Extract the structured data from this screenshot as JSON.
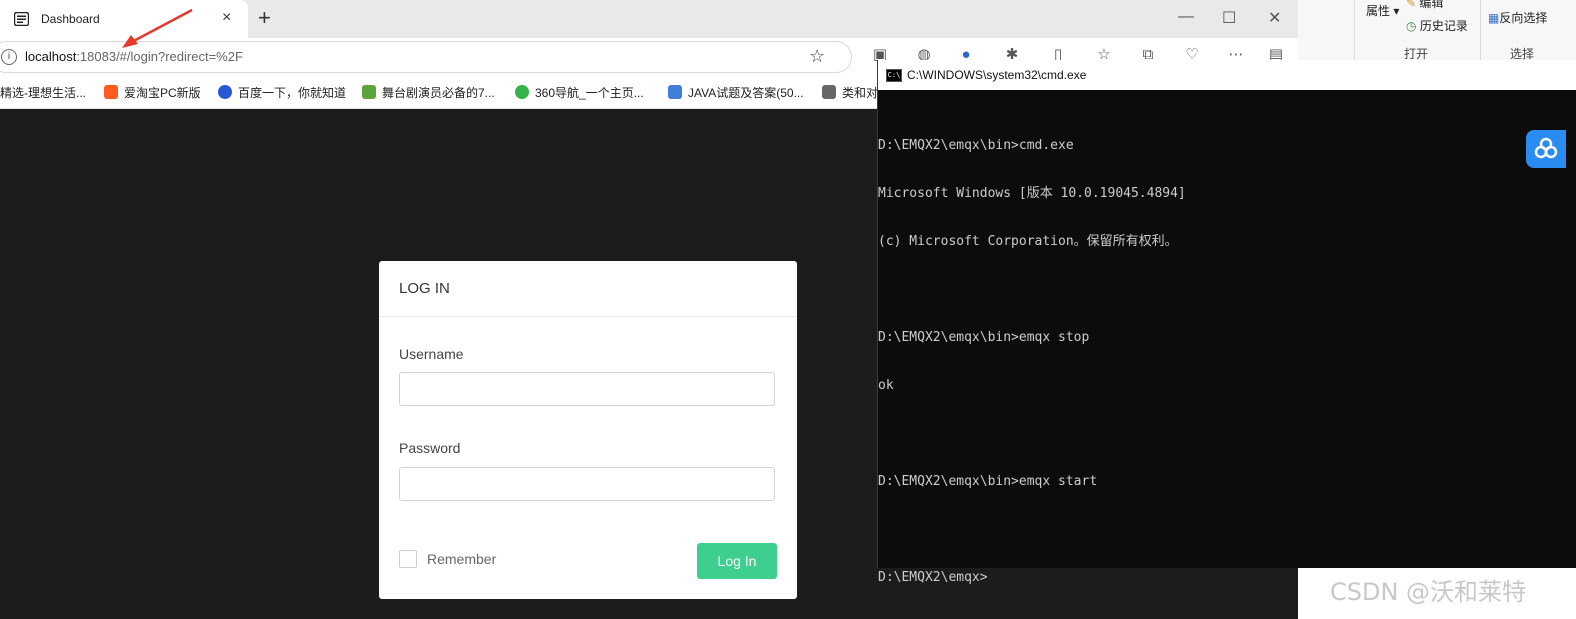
{
  "browser": {
    "tab": {
      "title": "Dashboard",
      "close": "×",
      "new_tab": "+"
    },
    "window_controls": {
      "minimize": "—",
      "maximize": "☐",
      "close": "✕"
    },
    "address": {
      "host": "localhost",
      "rest": ":18083/#/login?redirect=%2F"
    },
    "bookmarks": [
      {
        "label": "精选-理想生活...",
        "icon_color": "#e45d2f"
      },
      {
        "label": "爱淘宝PC新版",
        "icon_color": "#ff5a1f"
      },
      {
        "label": "百度一下，你就知道",
        "icon_color": "#2a57d8"
      },
      {
        "label": "舞台剧演员必备的7...",
        "icon_color": "#5ba33c"
      },
      {
        "label": "360导航_一个主页...",
        "icon_color": "#33b34a"
      },
      {
        "label": "JAVA试题及答案(50...",
        "icon_color": "#3f7fd9"
      },
      {
        "label": "类和对",
        "icon_color": "#666666"
      }
    ]
  },
  "login": {
    "title": "LOG IN",
    "username_label": "Username",
    "username_value": "",
    "password_label": "Password",
    "password_value": "",
    "remember_label": "Remember",
    "submit_label": "Log In",
    "accent_color": "#3ecf8e"
  },
  "cmd": {
    "title": "C:\\WINDOWS\\system32\\cmd.exe",
    "lines": [
      "D:\\EMQX2\\emqx\\bin>cmd.exe",
      "Microsoft Windows [版本 10.0.19045.4894]",
      "(c) Microsoft Corporation。保留所有权利。",
      "",
      "D:\\EMQX2\\emqx\\bin>emqx stop",
      "ok",
      "",
      "D:\\EMQX2\\emqx\\bin>emqx start",
      "",
      "D:\\EMQX2\\emqx>"
    ]
  },
  "explorer": {
    "properties": "属性",
    "edit": "编辑",
    "history": "历史记录",
    "invert_selection": "反向选择",
    "open_group": "打开",
    "select_group": "选择"
  },
  "watermark": "CSDN @沃和莱特"
}
